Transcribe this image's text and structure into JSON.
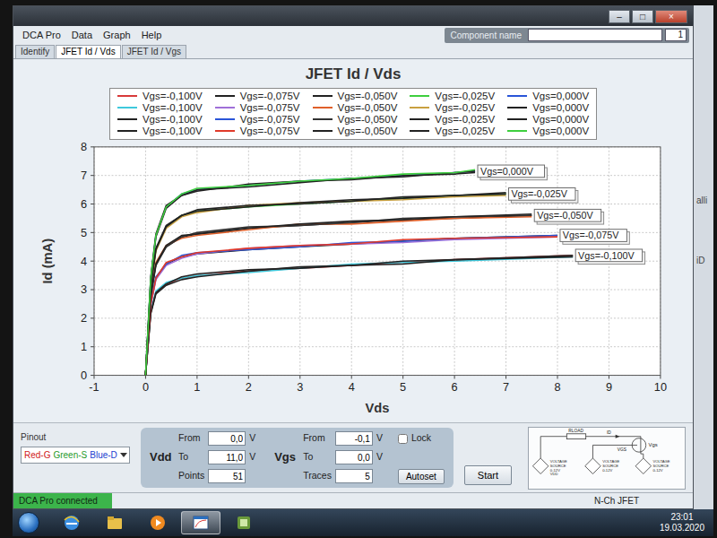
{
  "window": {
    "buttons": [
      "–",
      "□",
      "×"
    ],
    "component_name": {
      "label": "Component name",
      "value": "1"
    }
  },
  "menu": [
    "DCA Pro",
    "Data",
    "Graph",
    "Help"
  ],
  "tabs": [
    {
      "label": "Identify",
      "selected": false
    },
    {
      "label": "JFET Id / Vds",
      "selected": true
    },
    {
      "label": "JFET Id / Vgs",
      "selected": false
    }
  ],
  "chart": {
    "title": "JFET Id / Vds",
    "x_axis": {
      "title": "Vds",
      "ticks": [
        "-1",
        "0",
        "1",
        "2",
        "3",
        "4",
        "5",
        "6",
        "7",
        "8",
        "9",
        "10"
      ]
    },
    "y_axis": {
      "title": "Id (mA)",
      "ticks": [
        "0",
        "1",
        "2",
        "3",
        "4",
        "5",
        "6",
        "7",
        "8"
      ]
    },
    "series": [
      {
        "label": "Vgs=-0,100V",
        "color": "#d83a3a",
        "vds": [
          0,
          0.1,
          0.2,
          0.4,
          0.7,
          1,
          2,
          3,
          4,
          5,
          6,
          8.3
        ],
        "id": [
          0,
          2.2,
          2.9,
          3.2,
          3.4,
          3.5,
          3.65,
          3.75,
          3.85,
          3.95,
          4.05,
          4.2
        ]
      },
      {
        "label": "Vgs=-0,075V",
        "color": "#222222",
        "vds": [
          0,
          0.1,
          0.2,
          0.4,
          0.7,
          1,
          2,
          3,
          4,
          5,
          6,
          8
        ],
        "id": [
          0,
          2.5,
          3.4,
          3.9,
          4.15,
          4.25,
          4.4,
          4.5,
          4.6,
          4.7,
          4.8,
          4.9
        ]
      },
      {
        "label": "Vgs=-0,050V",
        "color": "#222222",
        "vds": [
          0,
          0.1,
          0.2,
          0.4,
          0.7,
          1,
          2,
          3,
          4,
          5,
          6,
          7.5
        ],
        "id": [
          0,
          2.8,
          3.9,
          4.5,
          4.85,
          4.95,
          5.15,
          5.25,
          5.35,
          5.45,
          5.5,
          5.6
        ]
      },
      {
        "label": "Vgs=-0,025V",
        "color": "#3ecf3e",
        "vds": [
          0,
          0.1,
          0.2,
          0.4,
          0.7,
          1,
          2,
          3,
          4,
          5,
          6,
          7
        ],
        "id": [
          0,
          3.1,
          4.4,
          5.2,
          5.6,
          5.75,
          5.9,
          6.0,
          6.1,
          6.2,
          6.3,
          6.35
        ]
      },
      {
        "label": "Vgs=0,000V",
        "color": "#2a55d8",
        "vds": [
          0,
          0.1,
          0.2,
          0.4,
          0.7,
          1,
          2,
          3,
          4,
          5,
          6,
          6.4
        ],
        "id": [
          0,
          3.4,
          4.9,
          5.9,
          6.35,
          6.5,
          6.65,
          6.8,
          6.9,
          7.0,
          7.1,
          7.15
        ]
      },
      {
        "label": "Vgs=-0,100V",
        "color": "#3fc9dc",
        "vds": [
          0,
          0.1,
          0.2,
          0.4,
          0.7,
          1,
          2,
          3,
          4,
          5,
          6,
          8.3
        ],
        "id": [
          0,
          2.25,
          2.95,
          3.25,
          3.4,
          3.5,
          3.6,
          3.75,
          3.9,
          3.95,
          4.0,
          4.15
        ]
      },
      {
        "label": "Vgs=-0,075V",
        "color": "#a070d8",
        "vds": [
          0,
          0.1,
          0.2,
          0.4,
          0.7,
          1,
          2,
          3,
          4,
          5,
          6,
          8
        ],
        "id": [
          0,
          2.45,
          3.35,
          3.85,
          4.1,
          4.25,
          4.45,
          4.55,
          4.6,
          4.65,
          4.75,
          4.85
        ]
      },
      {
        "label": "Vgs=-0,050V",
        "color": "#e0602a",
        "vds": [
          0,
          0.1,
          0.2,
          0.4,
          0.7,
          1,
          2,
          3,
          4,
          5,
          6,
          7.5
        ],
        "id": [
          0,
          2.85,
          3.95,
          4.55,
          4.8,
          4.9,
          5.1,
          5.3,
          5.3,
          5.4,
          5.5,
          5.55
        ]
      },
      {
        "label": "Vgs=-0,025V",
        "color": "#c9a040",
        "vds": [
          0,
          0.1,
          0.2,
          0.4,
          0.7,
          1,
          2,
          3,
          4,
          5,
          6,
          7
        ],
        "id": [
          0,
          3.05,
          4.35,
          5.15,
          5.55,
          5.7,
          5.95,
          6.05,
          6.1,
          6.15,
          6.25,
          6.3
        ]
      },
      {
        "label": "Vgs=0,000V",
        "color": "#222222",
        "vds": [
          0,
          0.1,
          0.2,
          0.4,
          0.7,
          1,
          2,
          3,
          4,
          5,
          6,
          6.4
        ],
        "id": [
          0,
          3.45,
          4.95,
          5.95,
          6.3,
          6.45,
          6.7,
          6.8,
          6.85,
          7.0,
          7.05,
          7.1
        ]
      },
      {
        "label": "Vgs=-0,100V",
        "color": "#222222",
        "vds": [
          0,
          0.1,
          0.2,
          0.4,
          0.7,
          1,
          2,
          3,
          4,
          5,
          6,
          8.3
        ],
        "id": [
          0,
          2.15,
          2.85,
          3.15,
          3.35,
          3.45,
          3.65,
          3.8,
          3.85,
          3.9,
          4.05,
          4.15
        ]
      },
      {
        "label": "Vgs=-0,075V",
        "color": "#2a55d8",
        "vds": [
          0,
          0.1,
          0.2,
          0.4,
          0.7,
          1,
          2,
          3,
          4,
          5,
          6,
          8
        ],
        "id": [
          0,
          2.55,
          3.45,
          3.9,
          4.2,
          4.3,
          4.4,
          4.5,
          4.65,
          4.7,
          4.8,
          4.9
        ]
      },
      {
        "label": "Vgs=-0,050V",
        "color": "#333333",
        "vds": [
          0,
          0.1,
          0.2,
          0.4,
          0.7,
          1,
          2,
          3,
          4,
          5,
          6,
          7.5
        ],
        "id": [
          0,
          2.75,
          3.85,
          4.5,
          4.85,
          5.0,
          5.2,
          5.25,
          5.35,
          5.5,
          5.55,
          5.6
        ]
      },
      {
        "label": "Vgs=-0,025V",
        "color": "#222222",
        "vds": [
          0,
          0.1,
          0.2,
          0.4,
          0.7,
          1,
          2,
          3,
          4,
          5,
          6,
          7
        ],
        "id": [
          0,
          3.15,
          4.45,
          5.25,
          5.6,
          5.75,
          5.9,
          6.05,
          6.15,
          6.2,
          6.3,
          6.4
        ]
      },
      {
        "label": "Vgs=0,000V",
        "color": "#222222",
        "vds": [
          0,
          0.1,
          0.2,
          0.4,
          0.7,
          1,
          2,
          3,
          4,
          5,
          6,
          6.4
        ],
        "id": [
          0,
          3.35,
          4.85,
          5.85,
          6.3,
          6.5,
          6.6,
          6.75,
          6.9,
          6.95,
          7.1,
          7.15
        ]
      },
      {
        "label": "Vgs=-0,100V",
        "color": "#222222",
        "vds": [
          0,
          0.1,
          0.2,
          0.4,
          0.7,
          1,
          2,
          3,
          4,
          5,
          6,
          8.3
        ],
        "id": [
          0,
          2.2,
          2.9,
          3.2,
          3.45,
          3.55,
          3.7,
          3.75,
          3.85,
          4.0,
          4.05,
          4.2
        ]
      },
      {
        "label": "Vgs=-0,075V",
        "color": "#e03a2a",
        "vds": [
          0,
          0.1,
          0.2,
          0.4,
          0.7,
          1,
          2,
          3,
          4,
          5,
          6,
          8
        ],
        "id": [
          0,
          2.5,
          3.4,
          3.95,
          4.15,
          4.3,
          4.45,
          4.55,
          4.6,
          4.75,
          4.8,
          4.85
        ]
      },
      {
        "label": "Vgs=-0,050V",
        "color": "#222222",
        "vds": [
          0,
          0.1,
          0.2,
          0.4,
          0.7,
          1,
          2,
          3,
          4,
          5,
          6,
          7.5
        ],
        "id": [
          0,
          2.8,
          3.9,
          4.55,
          4.9,
          4.95,
          5.15,
          5.3,
          5.4,
          5.45,
          5.55,
          5.65
        ]
      },
      {
        "label": "Vgs=-0,025V",
        "color": "#222222",
        "vds": [
          0,
          0.1,
          0.2,
          0.4,
          0.7,
          1,
          2,
          3,
          4,
          5,
          6,
          7
        ],
        "id": [
          0,
          3.1,
          4.4,
          5.2,
          5.6,
          5.8,
          5.95,
          6.0,
          6.1,
          6.25,
          6.3,
          6.35
        ]
      },
      {
        "label": "Vgs=0,000V",
        "color": "#3ecf3e",
        "vds": [
          0,
          0.1,
          0.2,
          0.4,
          0.7,
          1,
          2,
          3,
          4,
          5,
          6,
          6.4
        ],
        "id": [
          0,
          3.4,
          4.9,
          5.9,
          6.35,
          6.55,
          6.65,
          6.8,
          6.9,
          7.05,
          7.1,
          7.2
        ]
      }
    ],
    "callouts": [
      {
        "label": "Vgs=0,000V",
        "vds": 6.4,
        "id": 7.15
      },
      {
        "label": "Vgs=-0,025V",
        "vds": 7.0,
        "id": 6.35
      },
      {
        "label": "Vgs=-0,050V",
        "vds": 7.5,
        "id": 5.6
      },
      {
        "label": "Vgs=-0,075V",
        "vds": 8.0,
        "id": 4.9
      },
      {
        "label": "Vgs=-0,100V",
        "vds": 8.3,
        "id": 4.2
      }
    ]
  },
  "pinout": {
    "label": "Pinout",
    "parts": [
      {
        "text": "Red-G",
        "color": "#d02020"
      },
      {
        "text": "Green-S",
        "color": "#1f9a2c"
      },
      {
        "text": "Blue-D",
        "color": "#2040d0"
      }
    ]
  },
  "controls": {
    "vdd": {
      "label": "Vdd",
      "from_label": "From",
      "from": "0,0",
      "to_label": "To",
      "to": "11,0",
      "unit": "V",
      "count_label": "Points",
      "count": "51"
    },
    "vgs": {
      "label": "Vgs",
      "from_label": "From",
      "from": "-0,1",
      "to_label": "To",
      "to": "0,0",
      "unit": "V",
      "count_label": "Traces",
      "count": "5"
    },
    "lock": {
      "label": "Lock",
      "checked": false
    },
    "autoset": "Autoset",
    "start": "Start"
  },
  "schematic": {
    "rload": "RLOAD",
    "id": "ID",
    "vgs_source": "VGS",
    "vgs_pin": "Vgs",
    "sources": [
      {
        "lines": [
          "VOLTAGE",
          "SOURCE",
          "0-12V",
          "VDD"
        ]
      },
      {
        "lines": [
          "VOLTAGE",
          "SOURCE",
          "0-12V"
        ]
      },
      {
        "lines": [
          "VOLTAGE",
          "SOURCE",
          "0-12V"
        ]
      }
    ]
  },
  "status_bar": {
    "connection": "DCA Pro connected",
    "device": "N-Ch JFET"
  },
  "taskbar": {
    "apps": [
      {
        "selected": false
      },
      {
        "selected": false
      },
      {
        "selected": false
      },
      {
        "selected": true
      },
      {
        "selected": false
      }
    ],
    "time": "23:01",
    "date": "19.03.2020"
  },
  "background_window": {
    "fragments": [
      "alli",
      "iD"
    ]
  }
}
